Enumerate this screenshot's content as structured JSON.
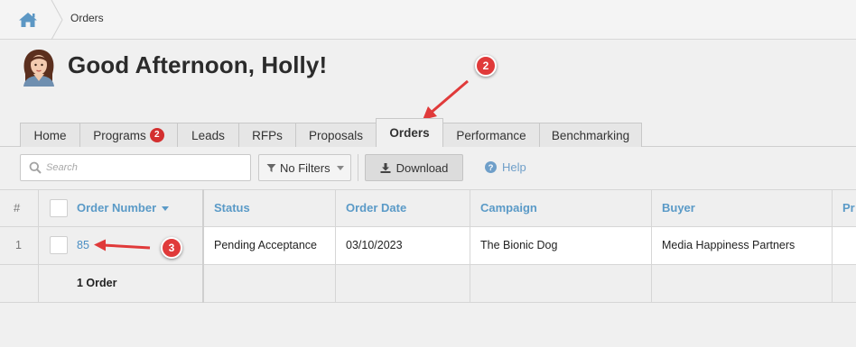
{
  "breadcrumb": {
    "current": "Orders"
  },
  "greeting": "Good Afternoon, Holly!",
  "tabs": [
    {
      "label": "Home"
    },
    {
      "label": "Programs",
      "badge": "2"
    },
    {
      "label": "Leads"
    },
    {
      "label": "RFPs"
    },
    {
      "label": "Proposals"
    },
    {
      "label": "Orders",
      "active": true
    },
    {
      "label": "Performance"
    },
    {
      "label": "Benchmarking"
    }
  ],
  "toolbar": {
    "search_placeholder": "Search",
    "filters_label": "No Filters",
    "download_label": "Download",
    "help_label": "Help"
  },
  "table": {
    "headers": {
      "index": "#",
      "order_number": "Order Number",
      "status": "Status",
      "order_date": "Order Date",
      "campaign": "Campaign",
      "buyer": "Buyer",
      "truncated": "Pr"
    },
    "rows": [
      {
        "index": "1",
        "order_number": "85",
        "status": "Pending Acceptance",
        "order_date": "03/10/2023",
        "campaign": "The Bionic Dog",
        "buyer": "Media Happiness Partners"
      }
    ],
    "footer": "1 Order"
  },
  "annotations": {
    "step2": "2",
    "step3": "3"
  },
  "colors": {
    "accent": "#5a9ac7",
    "badge_red": "#d32f2f",
    "annotation_red": "#e03a3a",
    "link_blue": "#4a8ec4"
  }
}
